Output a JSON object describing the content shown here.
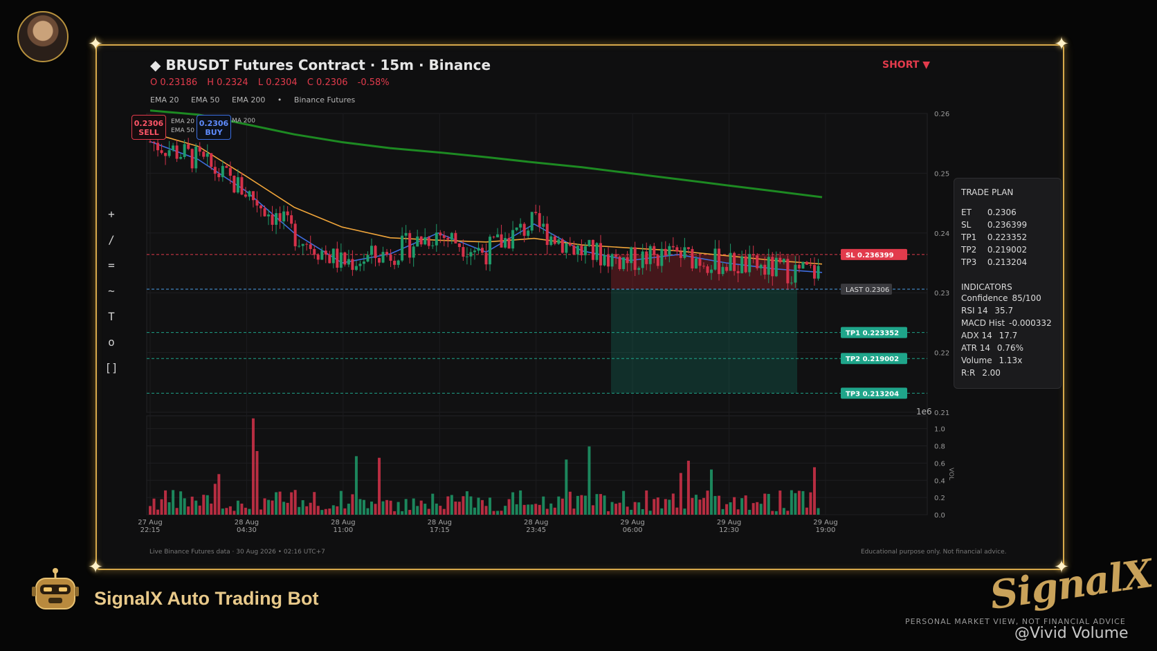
{
  "header": {
    "title": "◆  BRUSDT Futures Contract  ·  15m  ·  Binance",
    "ohlc": {
      "open": "O 0.23186",
      "high": "H 0.2324",
      "low": "L 0.2304",
      "close": "C 0.2306",
      "change": "-0.58%"
    },
    "ema_legend": [
      "EMA 20",
      "EMA 50",
      "EMA 200",
      "•",
      "Binance Futures"
    ],
    "side_button": "SHORT ▼"
  },
  "badges": {
    "sell_price": "0.2306",
    "sell_label": "SELL",
    "buy_price": "0.2306",
    "buy_label": "BUY",
    "hidden_legend_1": "EMA 20",
    "hidden_legend_2": "EMA 50",
    "hidden_legend_3": "MA 200"
  },
  "toolbar": [
    "+",
    "/",
    "=",
    "~",
    "T",
    "o",
    "[]"
  ],
  "chart_data": {
    "type": "candlestick",
    "symbol": "BRUSDT",
    "interval": "15m",
    "price_axis": {
      "ylim": [
        0.21,
        0.26
      ],
      "ticks": [
        "0.26",
        "0.25",
        "0.24",
        "0.23",
        "0.22",
        "0.21"
      ]
    },
    "volume_axis": {
      "ylim": [
        0,
        1.15
      ],
      "ticks": [
        "1.0",
        "0.8",
        "0.6",
        "0.4",
        "0.2",
        "0.0"
      ],
      "label": "VOL",
      "multiplier": "1e6"
    },
    "x_ticks": [
      {
        "line1": "27 Aug",
        "line2": "22:15"
      },
      {
        "line1": "28 Aug",
        "line2": "04:30"
      },
      {
        "line1": "28 Aug",
        "line2": "11:00"
      },
      {
        "line1": "28 Aug",
        "line2": "17:15"
      },
      {
        "line1": "28 Aug",
        "line2": "23:45"
      },
      {
        "line1": "29 Aug",
        "line2": "06:00"
      },
      {
        "line1": "29 Aug",
        "line2": "12:30"
      },
      {
        "line1": "29 Aug",
        "line2": "19:00"
      }
    ],
    "series": [
      {
        "name": "EMA 20",
        "color": "#3f6ee0",
        "values": [
          0.2553,
          0.2523,
          0.247,
          0.24,
          0.235,
          0.2365,
          0.24,
          0.2368,
          0.2415,
          0.237,
          0.2354,
          0.2364,
          0.235,
          0.234,
          0.2334
        ]
      },
      {
        "name": "EMA 50",
        "color": "#f0a53a",
        "values": [
          0.2568,
          0.2545,
          0.2495,
          0.2443,
          0.241,
          0.2392,
          0.2388,
          0.2385,
          0.2391,
          0.238,
          0.2375,
          0.237,
          0.2362,
          0.2354,
          0.2348
        ]
      },
      {
        "name": "EMA 200",
        "color": "#1d8a22",
        "values": [
          0.2605,
          0.2598,
          0.2582,
          0.2565,
          0.2552,
          0.2542,
          0.2535,
          0.2527,
          0.2518,
          0.251,
          0.25,
          0.249,
          0.248,
          0.247,
          0.246
        ]
      }
    ],
    "price_levels": [
      {
        "label": "SL",
        "value": 0.236399,
        "text": "SL  0.236399",
        "color": "#e23b4c"
      },
      {
        "label": "LAST",
        "value": 0.2306,
        "text": "LAST  0.2306",
        "color": "#4aa0e8"
      },
      {
        "label": "TP1",
        "value": 0.223352,
        "text": "TP1  0.223352",
        "color": "#1fa58a"
      },
      {
        "label": "TP2",
        "value": 0.219002,
        "text": "TP2  0.219002",
        "color": "#1fa58a"
      },
      {
        "label": "TP3",
        "value": 0.213204,
        "text": "TP3  0.213204",
        "color": "#1fa58a"
      }
    ]
  },
  "trade_plan": {
    "title": "TRADE PLAN",
    "rows": [
      {
        "k": "ET",
        "v": "0.2306"
      },
      {
        "k": "SL",
        "v": "0.236399"
      },
      {
        "k": "TP1",
        "v": "0.223352"
      },
      {
        "k": "TP2",
        "v": "0.219002"
      },
      {
        "k": "TP3",
        "v": "0.213204"
      }
    ],
    "indicators_title": "INDICATORS",
    "indicators": [
      {
        "k": "Confidence",
        "v": "85/100"
      },
      {
        "k": "RSI 14",
        "v": "35.7"
      },
      {
        "k": "MACD Hist",
        "v": "-0.000332"
      },
      {
        "k": "ADX 14",
        "v": "17.7"
      },
      {
        "k": "ATR 14",
        "v": "0.76%"
      },
      {
        "k": "Volume",
        "v": "1.13x"
      },
      {
        "k": "R:R",
        "v": "2.00"
      }
    ]
  },
  "footer": {
    "left": "Live Binance Futures data  ·  30 Aug 2026 • 02:16 UTC+7",
    "right": "Educational purpose only. Not financial advice."
  },
  "branding": {
    "bot_name": "SignalX Auto Trading Bot",
    "logo": "SignalX",
    "tagline": "PERSONAL MARKET VIEW, NOT FINANCIAL ADVICE",
    "watermark": "@Vivid Volume"
  },
  "colors": {
    "frame": "#d7a94b",
    "up": "#1e9b6a",
    "down": "#d5324a",
    "background": "#0f0f10"
  }
}
